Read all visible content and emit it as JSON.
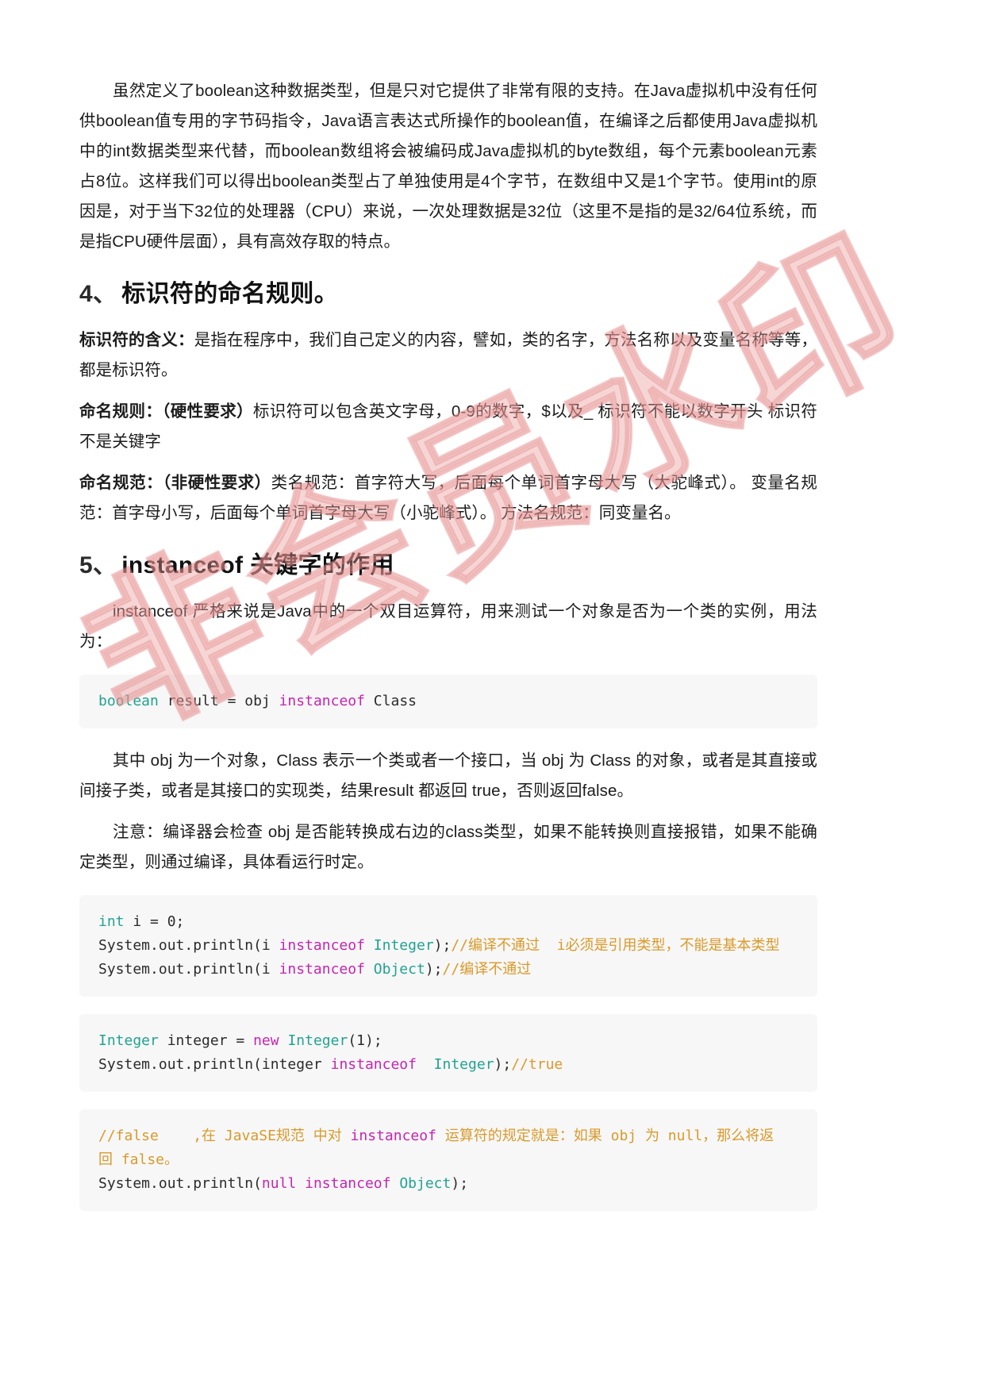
{
  "document": {
    "paragraphs": {
      "boolean_intro": "虽然定义了boolean这种数据类型，但是只对它提供了非常有限的支持。在Java虚拟机中没有任何供boolean值专用的字节码指令，Java语言表达式所操作的boolean值，在编译之后都使用Java虚拟机中的int数据类型来代替，而boolean数组将会被编码成Java虚拟机的byte数组，每个元素boolean元素占8位。这样我们可以得出boolean类型占了单独使用是4个字节，在数组中又是1个字节。使用int的原因是，对于当下32位的处理器（CPU）来说，一次处理数据是32位（这里不是指的是32/64位系统，而是指CPU硬件层面），具有高效存取的特点。"
    },
    "section4": {
      "number": "4、",
      "title": "标识符的命名规则。",
      "meaning_label": "标识符的含义：",
      "meaning_text": "是指在程序中，我们自己定义的内容，譬如，类的名字，方法名称以及变量名称等等，都是标识符。",
      "rule_label": "命名规则：（硬性要求）",
      "rule_text": "标识符可以包含英文字母，0-9的数字，$以及_ 标识符不能以数字开头 标识符不是关键字",
      "convention_label": "命名规范：（非硬性要求）",
      "convention_text": "类名规范：首字符大写，后面每个单词首字母大写（大驼峰式）。 变量名规范：首字母小写，后面每个单词首字母大写（小驼峰式）。 方法名规范：同变量名。"
    },
    "section5": {
      "number": "5、",
      "title": "instanceof 关键字的作用",
      "intro": "instanceof 严格来说是Java中的一个双目运算符，用来测试一个对象是否为一个类的实例，用法为：",
      "explain": "其中 obj 为一个对象，Class 表示一个类或者一个接口，当 obj 为 Class 的对象，或者是其直接或间接子类，或者是其接口的实现类，结果result 都返回 true，否则返回false。",
      "note": "注意：编译器会检查 obj 是否能转换成右边的class类型，如果不能转换则直接报错，如果不能确定类型，则通过编译，具体看运行时定。"
    },
    "code_blocks": {
      "block1": {
        "lines": [
          [
            {
              "t": "boolean",
              "c": "type"
            },
            {
              "t": " result ",
              "c": "plain"
            },
            {
              "t": "=",
              "c": "plain"
            },
            {
              "t": " obj ",
              "c": "plain"
            },
            {
              "t": "instanceof",
              "c": "kw"
            },
            {
              "t": " Class",
              "c": "plain"
            }
          ]
        ]
      },
      "block2": {
        "lines": [
          [
            {
              "t": "int",
              "c": "type"
            },
            {
              "t": " i ",
              "c": "plain"
            },
            {
              "t": "=",
              "c": "plain"
            },
            {
              "t": " 0;",
              "c": "plain"
            }
          ],
          [
            {
              "t": "System.out.println(i ",
              "c": "plain"
            },
            {
              "t": "instanceof",
              "c": "kw"
            },
            {
              "t": " ",
              "c": "plain"
            },
            {
              "t": "Integer",
              "c": "type"
            },
            {
              "t": ");",
              "c": "plain"
            },
            {
              "t": "//编译不通过  i必须是引用类型，不能是基本类型",
              "c": "cmt"
            }
          ],
          [
            {
              "t": "System.out.println(i ",
              "c": "plain"
            },
            {
              "t": "instanceof",
              "c": "kw"
            },
            {
              "t": " ",
              "c": "plain"
            },
            {
              "t": "Object",
              "c": "type"
            },
            {
              "t": ");",
              "c": "plain"
            },
            {
              "t": "//编译不通过",
              "c": "cmt"
            }
          ]
        ]
      },
      "block3": {
        "lines": [
          [
            {
              "t": "Integer",
              "c": "type"
            },
            {
              "t": " integer ",
              "c": "plain"
            },
            {
              "t": "=",
              "c": "plain"
            },
            {
              "t": " ",
              "c": "plain"
            },
            {
              "t": "new",
              "c": "kw"
            },
            {
              "t": " ",
              "c": "plain"
            },
            {
              "t": "Integer",
              "c": "type"
            },
            {
              "t": "(1);",
              "c": "plain"
            }
          ],
          [
            {
              "t": "System.out.println(integer ",
              "c": "plain"
            },
            {
              "t": "instanceof",
              "c": "kw"
            },
            {
              "t": "  ",
              "c": "plain"
            },
            {
              "t": "Integer",
              "c": "type"
            },
            {
              "t": ");",
              "c": "plain"
            },
            {
              "t": "//true",
              "c": "cmt"
            }
          ]
        ]
      },
      "block4": {
        "lines": [
          [
            {
              "t": "//false    ,在 JavaSE规范 中对 ",
              "c": "cmt"
            },
            {
              "t": "instanceof",
              "c": "kw"
            },
            {
              "t": " 运算符的规定就是：如果 obj 为 null，那么将返",
              "c": "cmt"
            }
          ],
          [
            {
              "t": "回 false。",
              "c": "cmt"
            }
          ],
          [
            {
              "t": "System.out.println(",
              "c": "plain"
            },
            {
              "t": "null",
              "c": "kw"
            },
            {
              "t": " ",
              "c": "plain"
            },
            {
              "t": "instanceof",
              "c": "kw"
            },
            {
              "t": " ",
              "c": "plain"
            },
            {
              "t": "Object",
              "c": "type"
            },
            {
              "t": ");",
              "c": "plain"
            }
          ]
        ]
      }
    },
    "watermark": {
      "text": "非会员水印",
      "color": "#e89696"
    },
    "colors": {
      "keyword": "#c724b1",
      "type": "#21a391",
      "comment": "#d99a2b",
      "code_background": "#f7f7f7",
      "text": "#1c1c1c"
    }
  }
}
